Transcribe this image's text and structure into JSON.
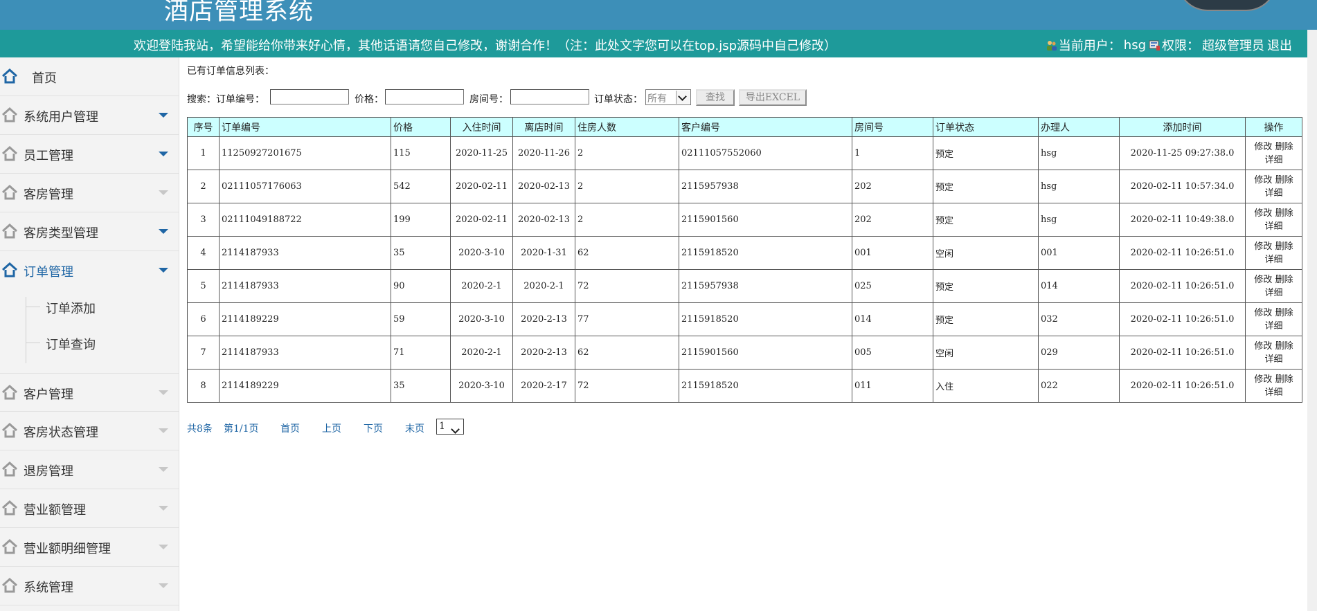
{
  "header": {
    "title": "酒店管理系统",
    "welcome": "欢迎登陆我站，希望能给你带来好心情，其他话语请您自己修改，谢谢合作！（注：此处文字您可以在top.jsp源码中自己修改）",
    "current_user_label": "当前用户：",
    "current_user": "hsg",
    "permission_label": "权限：",
    "permission": "超级管理员",
    "logout": "退出"
  },
  "sidebar": {
    "items": [
      {
        "label": "首页"
      },
      {
        "label": "系统用户管理"
      },
      {
        "label": "员工管理"
      },
      {
        "label": "客房管理"
      },
      {
        "label": "客房类型管理"
      },
      {
        "label": "订单管理"
      },
      {
        "label": "客户管理"
      },
      {
        "label": "客房状态管理"
      },
      {
        "label": "退房管理"
      },
      {
        "label": "营业额管理"
      },
      {
        "label": "营业额明细管理"
      },
      {
        "label": "系统管理"
      }
    ],
    "subitems": [
      {
        "label": "订单添加"
      },
      {
        "label": "订单查询"
      }
    ]
  },
  "main": {
    "list_title": "已有订单信息列表：",
    "search": {
      "prefix": "搜索：订单编号：",
      "order_no_value": "",
      "price_label": "价格：",
      "price_value": "",
      "room_label": "房间号：",
      "room_value": "",
      "status_label": "订单状态：",
      "status_selected": "所有",
      "find_button": "查找",
      "export_button": "导出EXCEL"
    },
    "columns": [
      "序号",
      "订单编号",
      "价格",
      "入住时间",
      "离店时间",
      "住房人数",
      "客户编号",
      "房间号",
      "订单状态",
      "办理人",
      "添加时间",
      "操作"
    ],
    "rows": [
      [
        "1",
        "11250927201675",
        "115",
        "2020-11-25",
        "2020-11-26",
        "2",
        "02111057552060",
        "1",
        "预定",
        "hsg",
        "2020-11-25 09:27:38.0"
      ],
      [
        "2",
        "02111057176063",
        "542",
        "2020-02-11",
        "2020-02-13",
        "2",
        "2115957938",
        "202",
        "预定",
        "hsg",
        "2020-02-11 10:57:34.0"
      ],
      [
        "3",
        "02111049188722",
        "199",
        "2020-02-11",
        "2020-02-13",
        "2",
        "2115901560",
        "202",
        "预定",
        "hsg",
        "2020-02-11 10:49:38.0"
      ],
      [
        "4",
        "2114187933",
        "35",
        "2020-3-10",
        "2020-1-31",
        "62",
        "2115918520",
        "001",
        "空闲",
        "001",
        "2020-02-11 10:26:51.0"
      ],
      [
        "5",
        "2114187933",
        "90",
        "2020-2-1",
        "2020-2-1",
        "72",
        "2115957938",
        "025",
        "预定",
        "014",
        "2020-02-11 10:26:51.0"
      ],
      [
        "6",
        "2114189229",
        "59",
        "2020-3-10",
        "2020-2-13",
        "77",
        "2115918520",
        "014",
        "预定",
        "032",
        "2020-02-11 10:26:51.0"
      ],
      [
        "7",
        "2114187933",
        "71",
        "2020-2-1",
        "2020-2-13",
        "62",
        "2115901560",
        "005",
        "空闲",
        "029",
        "2020-02-11 10:26:51.0"
      ],
      [
        "8",
        "2114189229",
        "35",
        "2020-3-10",
        "2020-2-17",
        "72",
        "2115918520",
        "011",
        "入住",
        "022",
        "2020-02-11 10:26:51.0"
      ]
    ],
    "ops": {
      "edit": "修改",
      "delete": "删除",
      "detail": "详细"
    },
    "pager": {
      "total": "共8条",
      "page": "第1/1页",
      "first": "首页",
      "prev": "上页",
      "next": "下页",
      "last": "末页",
      "page_select": "1"
    }
  },
  "colors": {
    "header_bg": "#3d8fb8",
    "welcome_bg": "#1e9a9a",
    "table_header_bg": "#ccffff",
    "link_blue": "#1f66a5"
  }
}
